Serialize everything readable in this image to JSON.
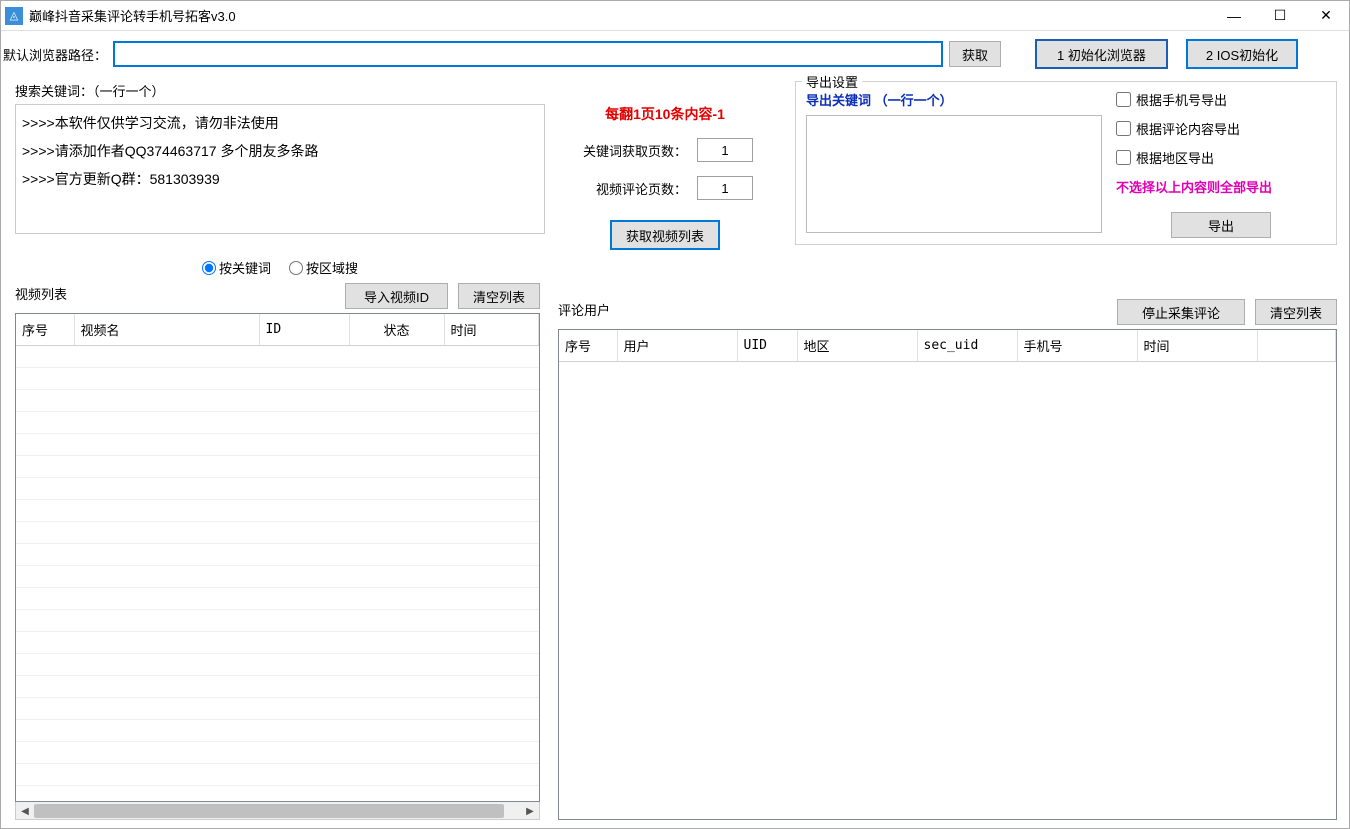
{
  "window": {
    "title": "巅峰抖音采集评论转手机号拓客v3.0"
  },
  "top": {
    "browser_path_label": "默认浏览器路径：",
    "browser_path_value": "",
    "get_button": "获取",
    "init_browser_button": "1 初始化浏览器",
    "ios_init_button": "2 IOS初始化"
  },
  "search": {
    "legend": "搜索关键词：（一行一个）",
    "textarea_value": ">>>>本软件仅供学习交流，请勿非法使用\n>>>>请添加作者QQ374463717 多个朋友多条路\n>>>>官方更新Q群：581303939",
    "red_hint": "每翻1页10条内容-1",
    "keyword_pages_label": "关键词获取页数：",
    "keyword_pages_value": "1",
    "comment_pages_label": "视频评论页数：",
    "comment_pages_value": "1",
    "get_video_list_button": "获取视频列表",
    "radio_by_keyword": "按关键词",
    "radio_by_region": "按区域搜"
  },
  "export": {
    "legend": "导出设置",
    "kw_label": "导出关键词  （一行一个）",
    "textarea_value": "",
    "chk_phone": "根据手机号导出",
    "chk_content": "根据评论内容导出",
    "chk_region": "根据地区导出",
    "magenta_hint": "不选择以上内容则全部导出",
    "export_button": "导出"
  },
  "video_list": {
    "title": "视频列表",
    "import_button": "导入视频ID",
    "clear_button": "清空列表",
    "columns": [
      "序号",
      "视频名",
      "ID",
      "状态",
      "时间"
    ]
  },
  "comment_list": {
    "title": "评论用户",
    "stop_button": "停止采集评论",
    "clear_button": "清空列表",
    "columns": [
      "序号",
      "用户",
      "UID",
      "地区",
      "sec_uid",
      "手机号",
      "时间"
    ]
  }
}
